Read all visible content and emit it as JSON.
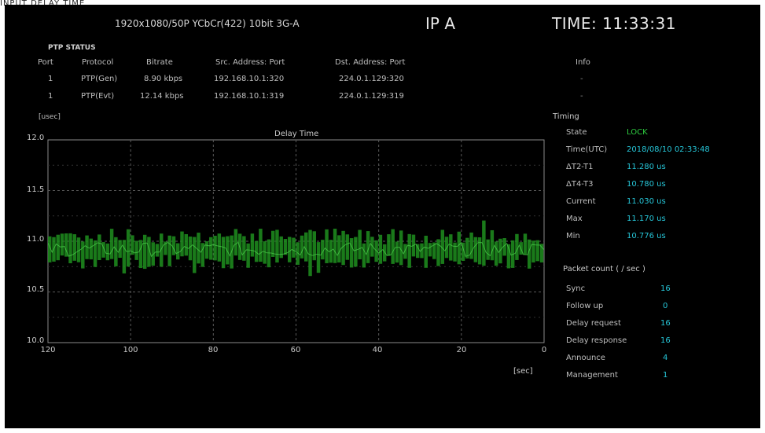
{
  "top_strip": "INPUT  DELAY TIME",
  "header": {
    "format": "1920x1080/50P YCbCr(422) 10bit 3G-A",
    "ip": "IP A",
    "time": "TIME: 11:33:31"
  },
  "ptp_status": {
    "title": "PTP STATUS",
    "columns": [
      "Port",
      "Protocol",
      "Bitrate",
      "Src. Address: Port",
      "Dst. Address: Port",
      "Info"
    ],
    "rows": [
      {
        "port": "1",
        "protocol": "PTP(Gen)",
        "bitrate": "8.90 kbps",
        "src": "192.168.10.1:320",
        "dst": "224.0.1.129:320",
        "info": "-"
      },
      {
        "port": "1",
        "protocol": "PTP(Evt)",
        "bitrate": "12.14 kbps",
        "src": "192.168.10.1:319",
        "dst": "224.0.1.129:319",
        "info": "-"
      }
    ]
  },
  "chart_data": {
    "type": "bar",
    "title": "Delay Time",
    "ylabel": "[usec]",
    "xlabel": "[sec]",
    "ylim": [
      10.0,
      12.0
    ],
    "xlim": [
      120,
      0
    ],
    "y_ticks": [
      "12.0",
      "11.5",
      "11.0",
      "10.5",
      "10.0"
    ],
    "x_ticks": [
      "120",
      "100",
      "80",
      "60",
      "40",
      "20",
      "0"
    ],
    "grid": true,
    "series": [
      {
        "color": "#1f8f1f",
        "mean": 10.92,
        "spread_low": 10.78,
        "spread_high": 11.08
      }
    ]
  },
  "timing": {
    "title": "Timing",
    "rows": [
      {
        "label": "State",
        "value": "LOCK"
      },
      {
        "label": "Time(UTC)",
        "value": "2018/08/10 02:33:48"
      },
      {
        "label": "ΔT2-T1",
        "value": "11.280 us"
      },
      {
        "label": "ΔT4-T3",
        "value": "10.780 us"
      },
      {
        "label": "Current",
        "value": "11.030 us"
      },
      {
        "label": "Max",
        "value": "11.170 us"
      },
      {
        "label": "Min",
        "value": "10.776 us"
      }
    ]
  },
  "packet_count": {
    "title": "Packet count ( / sec )",
    "rows": [
      {
        "label": "Sync",
        "value": "16"
      },
      {
        "label": "Follow up",
        "value": "0"
      },
      {
        "label": "Delay request",
        "value": "16"
      },
      {
        "label": "Delay response",
        "value": "16"
      },
      {
        "label": "Announce",
        "value": "4"
      },
      {
        "label": "Management",
        "value": "1"
      }
    ]
  },
  "colors": {
    "background": "#000000",
    "accent_value": "#26c6d8",
    "lock": "#2ecc40",
    "bars": "#1f8f1f"
  }
}
